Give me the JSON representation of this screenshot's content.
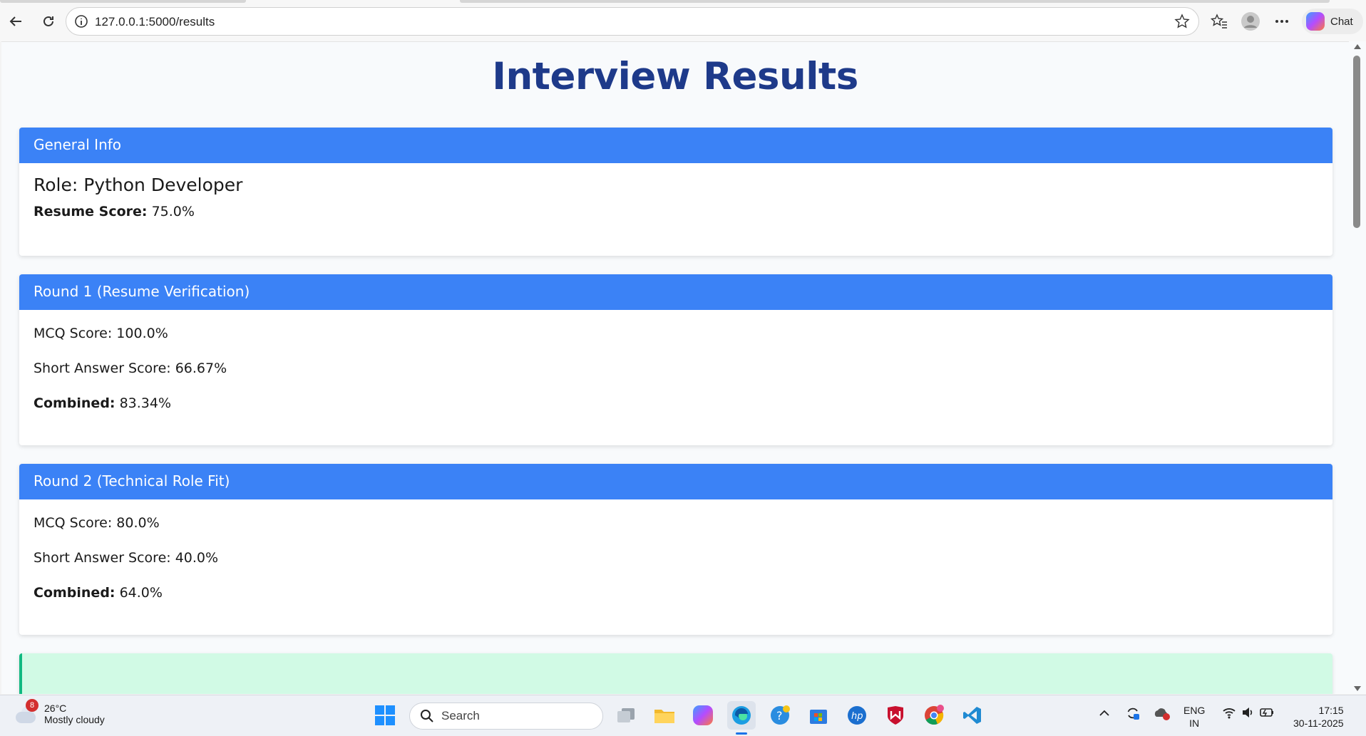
{
  "browser": {
    "url": "127.0.0.1:5000/results",
    "chat_label": "Chat"
  },
  "page": {
    "title": "Interview Results",
    "general": {
      "header": "General Info",
      "role": "Role: Python Developer",
      "resume_score_label": "Resume Score:",
      "resume_score_value": "75.0%"
    },
    "round1": {
      "header": "Round 1 (Resume Verification)",
      "mcq": "MCQ Score: 100.0%",
      "short": "Short Answer Score: 66.67%",
      "combined_label": "Combined:",
      "combined_value": "83.34%"
    },
    "round2": {
      "header": "Round 2 (Technical Role Fit)",
      "mcq": "MCQ Score: 80.0%",
      "short": "Short Answer Score: 40.0%",
      "combined_label": "Combined:",
      "combined_value": "64.0%"
    }
  },
  "taskbar": {
    "weather_temp": "26°C",
    "weather_desc": "Mostly cloudy",
    "weather_badge": "8",
    "search_placeholder": "Search",
    "lang_top": "ENG",
    "lang_bottom": "IN",
    "time": "17:15",
    "date": "30-11-2025"
  },
  "colors": {
    "header_blue": "#3b82f6",
    "title_navy": "#1e3a8a",
    "success_green": "#d1fae5"
  }
}
